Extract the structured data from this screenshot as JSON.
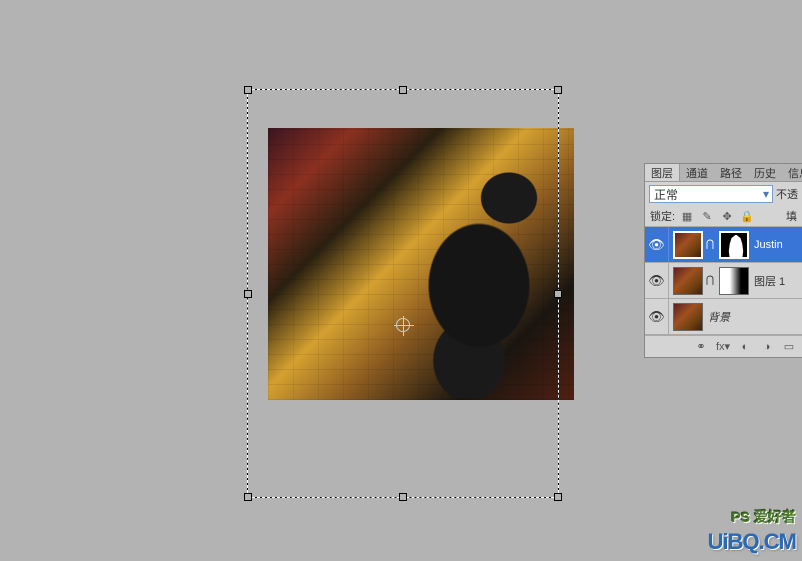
{
  "panel": {
    "tabs": {
      "layers": "图层",
      "channels": "通道",
      "paths": "路径",
      "history": "历史",
      "info": "信息"
    },
    "blend_mode": "正常",
    "opacity_label": "不透",
    "lock_label": "锁定:",
    "fill_label": "填"
  },
  "layers": {
    "justin": "Justin",
    "layer1": "图层 1",
    "background": "背景"
  },
  "watermark": {
    "top": "PS 爱好者",
    "bottom": "UiBQ.CM"
  }
}
